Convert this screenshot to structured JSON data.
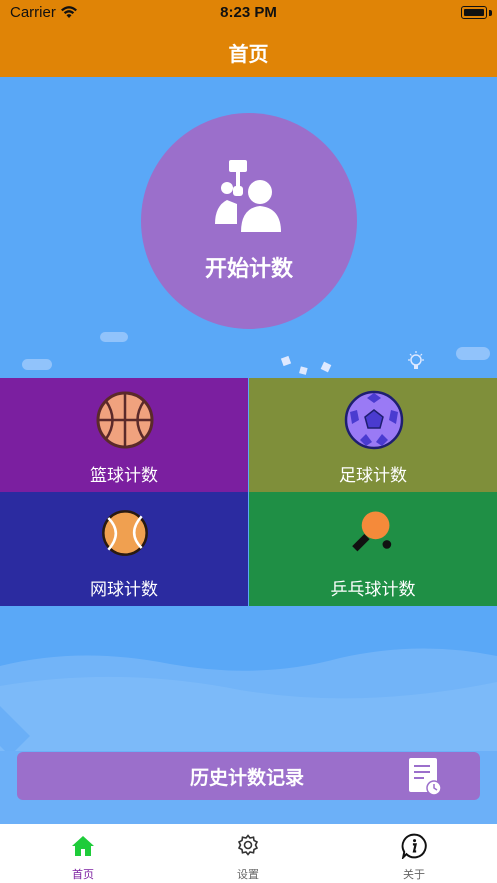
{
  "status_bar": {
    "carrier": "Carrier",
    "time": "8:23 PM"
  },
  "nav": {
    "title": "首页"
  },
  "hero": {
    "start_label": "开始计数"
  },
  "sports": [
    {
      "label": "篮球计数",
      "color": "#7b1fa0",
      "icon": "basketball-icon"
    },
    {
      "label": "足球计数",
      "color": "#7f8f3a",
      "icon": "soccer-ball-icon"
    },
    {
      "label": "网球计数",
      "color": "#2b2ba0",
      "icon": "tennis-ball-icon"
    },
    {
      "label": "乒乓球计数",
      "color": "#1f8f45",
      "icon": "ping-pong-icon"
    }
  ],
  "history": {
    "label": "历史计数记录"
  },
  "tabs": [
    {
      "label": "首页",
      "active": true,
      "icon": "home-icon"
    },
    {
      "label": "设置",
      "active": false,
      "icon": "gear-icon"
    },
    {
      "label": "关于",
      "active": false,
      "icon": "info-icon"
    }
  ],
  "colors": {
    "accent_orange": "#e08406",
    "background_blue": "#5aa8f7",
    "purple": "#9b6fcb",
    "tab_active": "#1ecc3a",
    "tab_active_label": "#7b1fa0"
  }
}
